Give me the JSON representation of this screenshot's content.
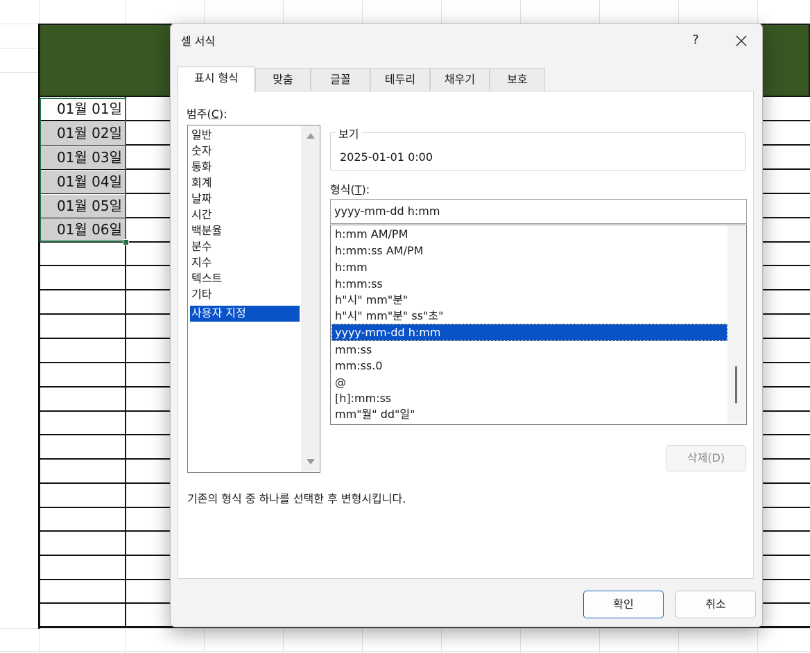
{
  "sheet": {
    "header_color": "#385723",
    "selection_color": "#217346",
    "dates": [
      "01월 01일",
      "01월 02일",
      "01월 03일",
      "01월 04일",
      "01월 05일",
      "01월 06일"
    ]
  },
  "dialog": {
    "title": "셀 서식",
    "help": "?",
    "close_icon": "close-icon",
    "tabs": [
      "표시 형식",
      "맞춤",
      "글꼴",
      "테두리",
      "채우기",
      "보호"
    ],
    "active_tab": "표시 형식",
    "category_label": "범주",
    "category_hotkey": "C",
    "categories": [
      "일반",
      "숫자",
      "통화",
      "회계",
      "날짜",
      "시간",
      "백분율",
      "분수",
      "지수",
      "텍스트",
      "기타",
      "사용자 지정"
    ],
    "selected_category": "사용자 지정",
    "sample_label": "보기",
    "sample_value": "2025-01-01 0:00",
    "format_label": "형식",
    "format_hotkey": "T",
    "format_value": "yyyy-mm-dd h:mm",
    "formats": [
      "h:mm AM/PM",
      "h:mm:ss AM/PM",
      "h:mm",
      "h:mm:ss",
      "h\"시\" mm\"분\"",
      "h\"시\" mm\"분\" ss\"초\"",
      "yyyy-mm-dd h:mm",
      "mm:ss",
      "mm:ss.0",
      "@",
      "[h]:mm:ss",
      "mm\"월\" dd\"일\""
    ],
    "selected_format": "yyyy-mm-dd h:mm",
    "delete_button": "삭제(D)",
    "description": "기존의 형식 중 하나를 선택한 후 변형시킵니다.",
    "ok_button": "확인",
    "cancel_button": "취소",
    "accent_color": "#0a52c8"
  }
}
